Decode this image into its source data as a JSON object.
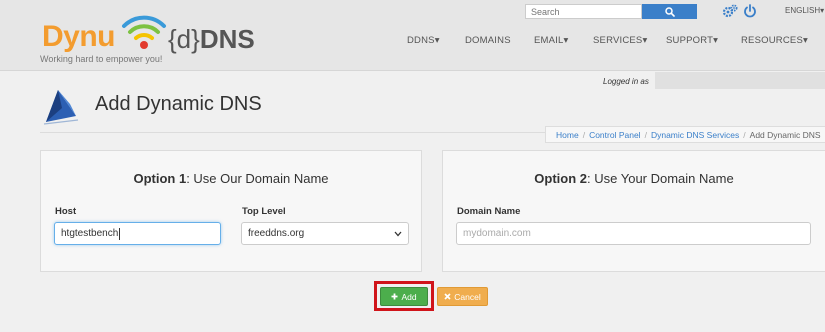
{
  "brand": {
    "name_part1": "Dynu",
    "name_part2_light": "{d}",
    "name_part2_bold": "DNS",
    "tagline": "Working hard to empower you!",
    "colors": {
      "orange": "#f39c2f",
      "wifi_blue": "#3a9ad9",
      "wifi_green": "#7dc242",
      "wifi_yellow": "#f5c400",
      "wifi_red": "#e23b2e"
    }
  },
  "search": {
    "placeholder": "Search",
    "button_icon": "search-icon"
  },
  "utilities": {
    "settings_icon": "gears-icon",
    "power_icon": "power-icon",
    "language": "ENGLISH"
  },
  "nav": [
    {
      "label": "DDNS",
      "has_dropdown": true
    },
    {
      "label": "DOMAINS",
      "has_dropdown": false
    },
    {
      "label": "EMAIL",
      "has_dropdown": true
    },
    {
      "label": "SERVICES",
      "has_dropdown": true
    },
    {
      "label": "SUPPORT",
      "has_dropdown": true
    },
    {
      "label": "RESOURCES",
      "has_dropdown": true
    }
  ],
  "session": {
    "logged_in_text": "Logged in as"
  },
  "page": {
    "title": "Add Dynamic DNS"
  },
  "breadcrumb": [
    {
      "label": "Home"
    },
    {
      "label": "Control Panel"
    },
    {
      "label": "Dynamic DNS Services"
    },
    {
      "label": "Add Dynamic DNS"
    }
  ],
  "option1": {
    "title_bold": "Option 1",
    "title_rest": ": Use Our Domain Name",
    "host_label": "Host",
    "host_value": "htgtestbench",
    "top_level_label": "Top Level",
    "top_level_value": "freeddns.org"
  },
  "option2": {
    "title_bold": "Option 2",
    "title_rest": ": Use Your Domain Name",
    "domain_label": "Domain Name",
    "domain_placeholder": "mydomain.com"
  },
  "actions": {
    "add_label": "Add",
    "add_icon": "plus-icon",
    "cancel_label": "Cancel",
    "cancel_icon": "x-icon",
    "highlight_color": "#d0141a"
  }
}
